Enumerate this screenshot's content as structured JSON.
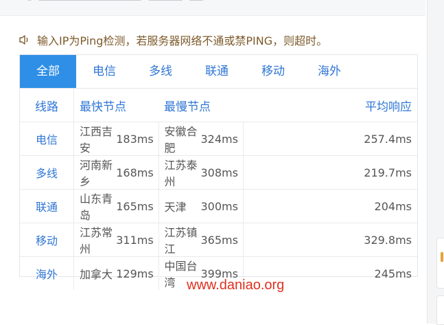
{
  "notice": {
    "icon": "speaker-icon",
    "text": "输入IP为Ping检测，若服务器网络不通或禁PING，则超时。"
  },
  "tabs": [
    {
      "label": "全部",
      "active": true
    },
    {
      "label": "电信",
      "active": false
    },
    {
      "label": "多线",
      "active": false
    },
    {
      "label": "联通",
      "active": false
    },
    {
      "label": "移动",
      "active": false
    },
    {
      "label": "海外",
      "active": false
    }
  ],
  "table": {
    "headers": {
      "line": "线路",
      "fastest": "最快节点",
      "slowest": "最慢节点",
      "average": "平均响应"
    },
    "rows": [
      {
        "line": "电信",
        "fast_node": "江西吉安",
        "fast_ms": "183ms",
        "slow_node": "安徽合肥",
        "slow_ms": "324ms",
        "avg": "257.4ms"
      },
      {
        "line": "多线",
        "fast_node": "河南新乡",
        "fast_ms": "168ms",
        "slow_node": "江苏泰州",
        "slow_ms": "308ms",
        "avg": "219.7ms"
      },
      {
        "line": "联通",
        "fast_node": "山东青岛",
        "fast_ms": "165ms",
        "slow_node": "天津",
        "slow_ms": "300ms",
        "avg": "204ms"
      },
      {
        "line": "移动",
        "fast_node": "江苏常州",
        "fast_ms": "311ms",
        "slow_node": "江苏镇江",
        "slow_ms": "365ms",
        "avg": "329.8ms"
      },
      {
        "line": "海外",
        "fast_node": "加拿大",
        "fast_ms": "129ms",
        "slow_node": "中国台湾",
        "slow_ms": "399ms",
        "avg": "245ms"
      }
    ]
  },
  "watermark": "www.daniao.org",
  "colors": {
    "accent": "#2f8fe6",
    "link": "#2f76d5",
    "notice": "#7c5a2a",
    "watermark": "#e0301e"
  }
}
